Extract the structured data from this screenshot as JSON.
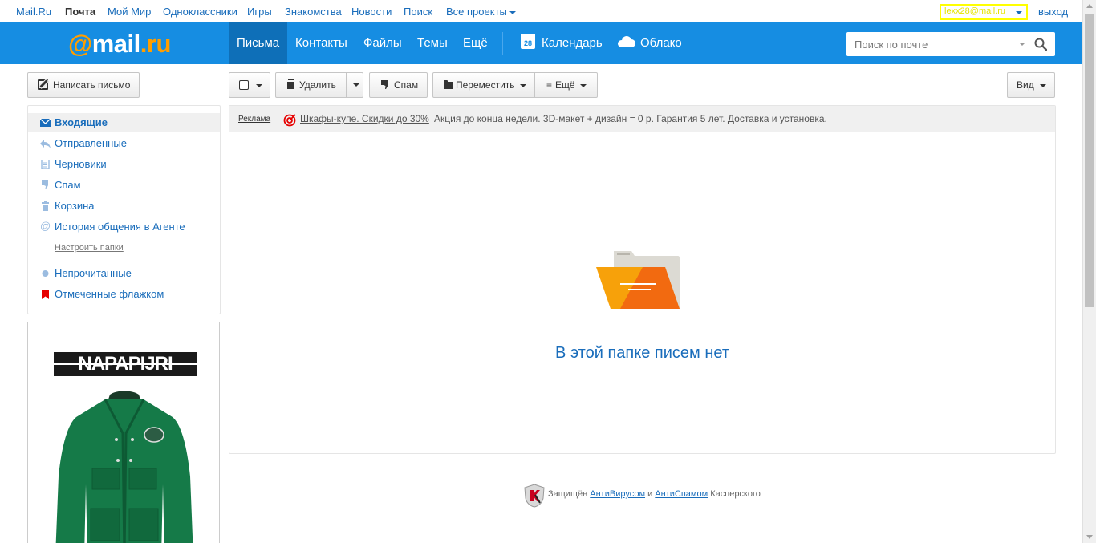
{
  "portal_nav": {
    "items": [
      "Mail.Ru",
      "Почта",
      "Мой Мир",
      "Одноклассники",
      "Игры",
      "Знакомства",
      "Новости",
      "Поиск",
      "Все проекты"
    ],
    "user_email": "lexx28@mail.ru",
    "logout": "выход"
  },
  "header": {
    "logo_at": "@",
    "logo_mail": "mail",
    "logo_dot": ".",
    "logo_ru": "ru",
    "tabs": [
      "Письма",
      "Контакты",
      "Файлы",
      "Темы",
      "Ещё"
    ],
    "active_tab": "Письма",
    "calendar_label": "Календарь",
    "calendar_day": "28",
    "cloud_label": "Облако",
    "search_placeholder": "Поиск по почте"
  },
  "compose_label": "Написать письмо",
  "sidebar": {
    "folders": [
      {
        "label": "Входящие",
        "icon": "envelope-icon",
        "active": true
      },
      {
        "label": "Отправленные",
        "icon": "reply-arrow-icon",
        "active": false
      },
      {
        "label": "Черновики",
        "icon": "document-icon",
        "active": false
      },
      {
        "label": "Спам",
        "icon": "thumbs-down-icon",
        "active": false
      },
      {
        "label": "Корзина",
        "icon": "trash-icon",
        "active": false
      },
      {
        "label": "История общения в Агенте",
        "icon": "at-sign-icon",
        "active": false
      }
    ],
    "configure_link": "Настроить папки",
    "filters": [
      {
        "label": "Непрочитанные",
        "icon": "unread-dot-icon"
      },
      {
        "label": "Отмеченные флажком",
        "icon": "flag-icon"
      }
    ]
  },
  "side_ad": {
    "brand": "NAPAPIJRI"
  },
  "toolbar": {
    "delete_label": "Удалить",
    "spam_label": "Спам",
    "move_label": "Переместить",
    "more_label": "Ещё",
    "view_label": "Вид"
  },
  "ad_line": {
    "label": "Реклама",
    "title": "Шкафы-купе. Скидки до 30%",
    "description": "Акция до конца недели. 3D-макет + дизайн = 0 р. Гарантия 5 лет. Доставка и установка."
  },
  "empty_message": "В этой папке писем нет",
  "footer": {
    "prefix": "Защищён",
    "antivirus": "АнтиВирусом",
    "and": "и",
    "antispam": "АнтиСпамом",
    "suffix": "Касперского"
  },
  "colors": {
    "header_blue": "#168de2",
    "active_tab": "#0e6fb8",
    "link_blue": "#1a6dbb",
    "logo_orange": "#ff9e00",
    "flag_red": "#e60000"
  }
}
